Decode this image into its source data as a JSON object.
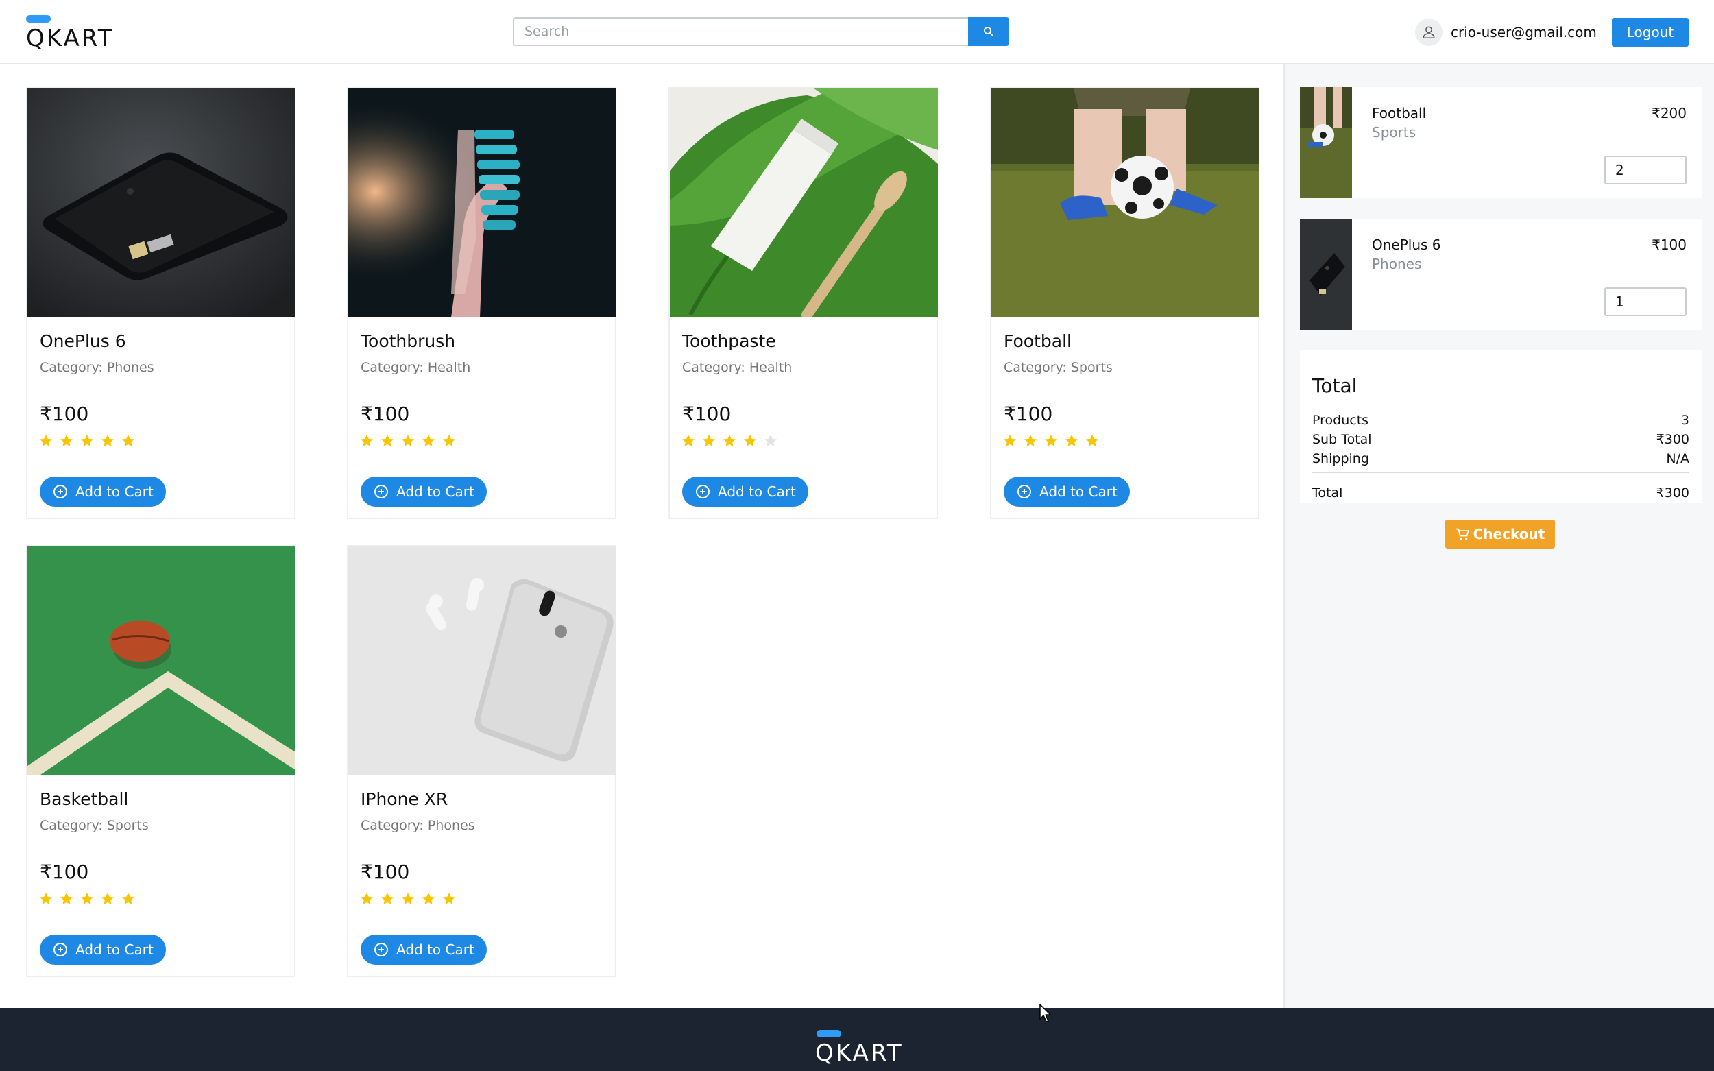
{
  "brand": {
    "name": "QKART"
  },
  "colors": {
    "primary": "#1e88e5",
    "accent": "#2f9bf7",
    "checkout": "#f0a326",
    "star": "#f7c600",
    "footer": "#1c2431"
  },
  "header": {
    "search_placeholder": "Search",
    "search_value": "",
    "user_email": "crio-user@gmail.com",
    "logout_label": "Logout"
  },
  "products": [
    {
      "name": "OnePlus 6",
      "category": "Category: Phones",
      "price": "₹100",
      "rating": 5,
      "add_label": "Add to Cart",
      "icon": "phone-photo"
    },
    {
      "name": "Toothbrush",
      "category": "Category: Health",
      "price": "₹100",
      "rating": 5,
      "add_label": "Add to Cart",
      "icon": "toothbrush-photo"
    },
    {
      "name": "Toothpaste",
      "category": "Category: Health",
      "price": "₹100",
      "rating": 4,
      "add_label": "Add to Cart",
      "icon": "toothpaste-photo"
    },
    {
      "name": "Football",
      "category": "Category: Sports",
      "price": "₹100",
      "rating": 5,
      "add_label": "Add to Cart",
      "icon": "football-photo"
    },
    {
      "name": "Basketball",
      "category": "Category: Sports",
      "price": "₹100",
      "rating": 5,
      "add_label": "Add to Cart",
      "icon": "basketball-photo"
    },
    {
      "name": "IPhone XR",
      "category": "Category: Phones",
      "price": "₹100",
      "rating": 5,
      "add_label": "Add to Cart",
      "icon": "iphone-photo"
    }
  ],
  "cart": {
    "items": [
      {
        "name": "Football",
        "category": "Sports",
        "price": "₹200",
        "qty": "2"
      },
      {
        "name": "OnePlus 6",
        "category": "Phones",
        "price": "₹100",
        "qty": "1"
      }
    ],
    "summary": {
      "title": "Total",
      "products_label": "Products",
      "products_value": "3",
      "subtotal_label": "Sub Total",
      "subtotal_value": "₹300",
      "shipping_label": "Shipping",
      "shipping_value": "N/A",
      "total_label": "Total",
      "total_value": "₹300"
    },
    "checkout_label": "Checkout"
  },
  "footer": {
    "brand": "QKART"
  }
}
